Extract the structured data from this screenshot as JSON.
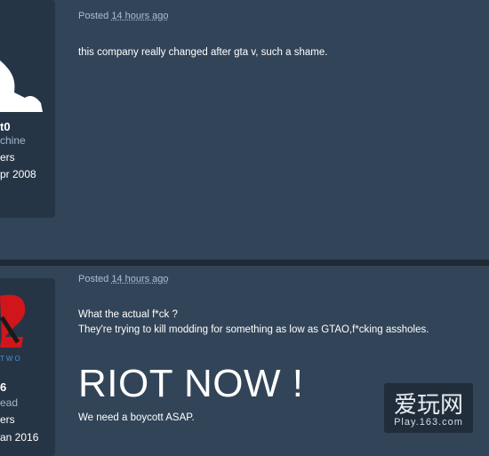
{
  "posts": [
    {
      "posted_label": "Posted",
      "time": "14 hours ago",
      "user": {
        "name": "t0",
        "title": "chine",
        "posts_label": "ers",
        "joined": "pr 2008"
      },
      "body": [
        "this company really changed after gta v, such a shame."
      ]
    },
    {
      "posted_label": "Posted",
      "time": "14 hours ago",
      "user": {
        "name": "6",
        "title": "ead",
        "posts_label": "ers",
        "joined": "an 2016",
        "logo_text": "TWO"
      },
      "body": [
        "What the actual f*ck ?",
        "They're trying to kill modding for something as low as GTAO,f*cking assholes."
      ],
      "big_text": "RIOT NOW !",
      "footer": "We need a boycott ASAP."
    }
  ],
  "watermark": {
    "title": "爱玩网",
    "sub": "Play.163.com"
  },
  "colors": {
    "bg": "#324458",
    "panel": "#263545",
    "divider": "#1f2a35",
    "meta": "#a9bfd3"
  }
}
